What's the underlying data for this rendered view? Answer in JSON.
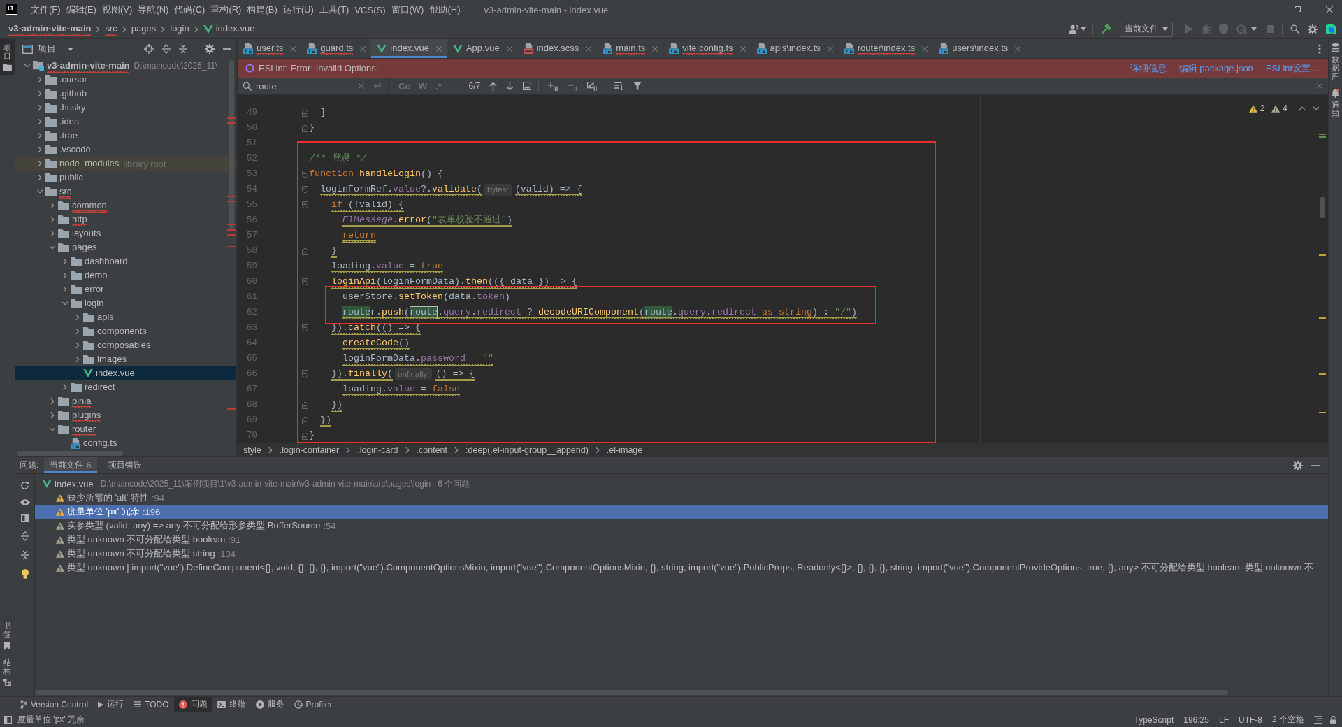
{
  "window": {
    "logo": "IJ",
    "menu": [
      "文件(F)",
      "编辑(E)",
      "视图(V)",
      "导航(N)",
      "代码(C)",
      "重构(R)",
      "构建(B)",
      "运行(U)",
      "工具(T)",
      "VCS(S)",
      "窗口(W)",
      "帮助(H)"
    ],
    "title": "v3-admin-vite-main - index.vue"
  },
  "navigation_bar": {
    "breadcrumbs": [
      {
        "label": "v3-admin-vite-main",
        "kind": "project",
        "has_errors": true
      },
      {
        "label": "src",
        "kind": "folder",
        "has_errors": true
      },
      {
        "label": "pages",
        "kind": "folder",
        "has_errors": false
      },
      {
        "label": "login",
        "kind": "folder",
        "has_errors": false
      },
      {
        "label": "index.vue",
        "kind": "vue",
        "has_errors": false
      }
    ],
    "run_configuration": "当前文件"
  },
  "left_strip": {
    "top": [
      {
        "label": "项目",
        "kind": "project",
        "selected": true
      }
    ],
    "bottom": [
      {
        "label": "书签",
        "kind": "bookmarks",
        "selected": false
      },
      {
        "label": "结构",
        "kind": "structure",
        "selected": false
      }
    ]
  },
  "right_strip": [
    {
      "label": "数据库",
      "kind": "database"
    },
    {
      "label": "通知",
      "kind": "notifications"
    }
  ],
  "project_panel": {
    "title": "项目",
    "tree": [
      {
        "label": "v3-admin-vite-main",
        "kind": "module",
        "path": "D:\\maincode\\2025_11\\",
        "expanded": true,
        "selected": false,
        "has_errors": true,
        "children": [
          {
            "label": ".cursor",
            "kind": "folder",
            "expanded": false,
            "selected": false,
            "has_errors": false
          },
          {
            "label": ".github",
            "kind": "folder",
            "expanded": false,
            "selected": false,
            "has_errors": false
          },
          {
            "label": ".husky",
            "kind": "folder",
            "expanded": false,
            "selected": false,
            "has_errors": false
          },
          {
            "label": ".idea",
            "kind": "folder",
            "expanded": false,
            "selected": false,
            "has_errors": false
          },
          {
            "label": ".trae",
            "kind": "folder",
            "expanded": false,
            "selected": false,
            "has_errors": false
          },
          {
            "label": ".vscode",
            "kind": "folder",
            "expanded": false,
            "selected": false,
            "has_errors": false
          },
          {
            "label": "node_modules",
            "kind": "library",
            "note": "library root",
            "expanded": false,
            "selected": false,
            "has_errors": false
          },
          {
            "label": "public",
            "kind": "folder",
            "expanded": false,
            "selected": false,
            "has_errors": false
          },
          {
            "label": "src",
            "kind": "folder",
            "expanded": true,
            "selected": false,
            "has_errors": true,
            "children": [
              {
                "label": "common",
                "kind": "folder",
                "expanded": false,
                "selected": false,
                "has_errors": true
              },
              {
                "label": "http",
                "kind": "folder",
                "expanded": false,
                "selected": false,
                "has_errors": true
              },
              {
                "label": "layouts",
                "kind": "folder",
                "expanded": false,
                "selected": false,
                "has_errors": false
              },
              {
                "label": "pages",
                "kind": "folder",
                "expanded": true,
                "selected": false,
                "has_errors": false,
                "children": [
                  {
                    "label": "dashboard",
                    "kind": "folder",
                    "expanded": false,
                    "selected": false,
                    "has_errors": false
                  },
                  {
                    "label": "demo",
                    "kind": "folder",
                    "expanded": false,
                    "selected": false,
                    "has_errors": false
                  },
                  {
                    "label": "error",
                    "kind": "folder",
                    "expanded": false,
                    "selected": false,
                    "has_errors": false
                  },
                  {
                    "label": "login",
                    "kind": "folder",
                    "expanded": true,
                    "selected": false,
                    "has_errors": false,
                    "children": [
                      {
                        "label": "apis",
                        "kind": "folder",
                        "expanded": false,
                        "selected": false,
                        "has_errors": false
                      },
                      {
                        "label": "components",
                        "kind": "folder",
                        "expanded": false,
                        "selected": false,
                        "has_errors": false
                      },
                      {
                        "label": "composables",
                        "kind": "folder",
                        "expanded": false,
                        "selected": false,
                        "has_errors": false
                      },
                      {
                        "label": "images",
                        "kind": "folder",
                        "expanded": false,
                        "selected": false,
                        "has_errors": false
                      },
                      {
                        "label": "index.vue",
                        "kind": "vue",
                        "selected": true,
                        "has_errors": false
                      }
                    ]
                  },
                  {
                    "label": "redirect",
                    "kind": "folder",
                    "expanded": false,
                    "selected": false,
                    "has_errors": false
                  }
                ]
              },
              {
                "label": "pinia",
                "kind": "folder",
                "expanded": false,
                "selected": false,
                "has_errors": true
              },
              {
                "label": "plugins",
                "kind": "folder",
                "expanded": false,
                "selected": false,
                "has_errors": true
              },
              {
                "label": "router",
                "kind": "folder",
                "expanded": true,
                "selected": false,
                "has_errors": true,
                "children": [
                  {
                    "label": "config.ts",
                    "kind": "ts",
                    "selected": false,
                    "has_errors": false
                  }
                ]
              }
            ]
          }
        ]
      }
    ]
  },
  "editor": {
    "tabs": [
      {
        "label": "user.ts",
        "kind": "ts",
        "selected": false,
        "has_errors": true
      },
      {
        "label": "guard.ts",
        "kind": "ts",
        "selected": false,
        "has_errors": true
      },
      {
        "label": "index.vue",
        "kind": "vue",
        "selected": true,
        "has_errors": false
      },
      {
        "label": "App.vue",
        "kind": "vue",
        "selected": false,
        "has_errors": false
      },
      {
        "label": "index.scss",
        "kind": "scss",
        "selected": false,
        "has_errors": false
      },
      {
        "label": "main.ts",
        "kind": "ts",
        "selected": false,
        "has_errors": true
      },
      {
        "label": "vite.config.ts",
        "kind": "ts",
        "selected": false,
        "has_errors": true
      },
      {
        "label": "apis\\index.ts",
        "kind": "ts",
        "selected": false,
        "has_errors": false
      },
      {
        "label": "router\\index.ts",
        "kind": "ts",
        "selected": false,
        "has_errors": true
      },
      {
        "label": "users\\index.ts",
        "kind": "ts",
        "selected": false,
        "has_errors": false
      }
    ],
    "notification": {
      "message": "ESLint: Error: Invalid Options:",
      "links": [
        "详细信息",
        "编辑 package.json",
        "ESLint设置..."
      ]
    },
    "find": {
      "query": "route",
      "toggles": [
        {
          "label": "Cc",
          "selected": false
        },
        {
          "label": "W",
          "selected": false
        },
        {
          "label": ".*",
          "selected": false
        }
      ],
      "count": "6/7"
    },
    "inspections": {
      "warnings": "2",
      "weak_warnings": "4"
    },
    "lines": [
      {
        "number": "49",
        "kind": "closing",
        "warning": false,
        "tokens": [
          {
            "text": "  ]",
            "kind": "plain"
          }
        ]
      },
      {
        "number": "50",
        "kind": "closing",
        "warning": false,
        "tokens": [
          {
            "text": "}",
            "kind": "plain"
          }
        ]
      },
      {
        "kind": "annotation",
        "lines": [
          {
            "number": "51",
            "kind": "body"
          },
          {
            "number": "52",
            "kind": "body",
            "warning": false,
            "tokens": [
              {
                "text": "/** 登录 */",
                "kind": "doc"
              }
            ]
          },
          {
            "number": "53",
            "kind": "opening",
            "warning": false,
            "tokens": [
              {
                "text": "function",
                "kind": "keyword"
              },
              {
                "text": " handleLogin",
                "kind": "func"
              },
              {
                "text": "() {",
                "kind": "plain"
              }
            ]
          },
          {
            "number": "54",
            "kind": "opening",
            "warning": true,
            "tokens": [
              {
                "text": "  loginFormRef.",
                "kind": "plain"
              },
              {
                "text": "value",
                "kind": "prop"
              },
              {
                "text": "?.",
                "kind": "plain"
              },
              {
                "text": "validate",
                "kind": "func"
              },
              {
                "text": "(",
                "kind": "plain"
              },
              {
                "text": "bytes:",
                "kind": "hint"
              },
              {
                "text": "(valid) => {",
                "kind": "plain"
              }
            ]
          },
          {
            "number": "55",
            "kind": "opening",
            "warning": true,
            "tokens": [
              {
                "text": "    if",
                "kind": "keyword"
              },
              {
                "text": " (!valid) {",
                "kind": "plain"
              }
            ]
          },
          {
            "number": "56",
            "kind": "body",
            "warning": true,
            "tokens": [
              {
                "text": "      ElMessage",
                "kind": "class"
              },
              {
                "text": ".",
                "kind": "plain"
              },
              {
                "text": "error",
                "kind": "func"
              },
              {
                "text": "(",
                "kind": "plain"
              },
              {
                "text": "\"表单校验不通过\"",
                "kind": "string"
              },
              {
                "text": ")",
                "kind": "plain"
              }
            ]
          },
          {
            "number": "57",
            "kind": "body",
            "warning": true,
            "tokens": [
              {
                "text": "      return",
                "kind": "keyword"
              }
            ]
          },
          {
            "number": "58",
            "kind": "closing",
            "warning": true,
            "tokens": [
              {
                "text": "    }",
                "kind": "plain"
              }
            ]
          },
          {
            "number": "59",
            "kind": "body",
            "warning": true,
            "tokens": [
              {
                "text": "    loading.",
                "kind": "plain"
              },
              {
                "text": "value",
                "kind": "prop"
              },
              {
                "text": " = ",
                "kind": "plain"
              },
              {
                "text": "true",
                "kind": "keyword"
              }
            ]
          },
          {
            "number": "60",
            "kind": "opening",
            "warning": true,
            "tokens": [
              {
                "text": "    loginApi",
                "kind": "func"
              },
              {
                "text": "(loginFormData).",
                "kind": "plain"
              },
              {
                "text": "then",
                "kind": "func"
              },
              {
                "text": "(({ data }) => {",
                "kind": "plain"
              }
            ]
          },
          {
            "kind": "annotation",
            "lines": [
              {
                "number": "61",
                "kind": "body",
                "warning": false,
                "tokens": [
                  {
                    "text": "      userStore.",
                    "kind": "plain"
                  },
                  {
                    "text": "setToken",
                    "kind": "func"
                  },
                  {
                    "text": "(data.",
                    "kind": "plain"
                  },
                  {
                    "text": "token",
                    "kind": "prop"
                  },
                  {
                    "text": ")",
                    "kind": "plain"
                  }
                ]
              },
              {
                "number": "62",
                "kind": "body",
                "warning": true,
                "tokens": [
                  {
                    "text": "      route",
                    "kind": "match"
                  },
                  {
                    "text": "r.",
                    "kind": "plain"
                  },
                  {
                    "text": "push",
                    "kind": "func"
                  },
                  {
                    "text": "(",
                    "kind": "plain"
                  },
                  {
                    "text": "route",
                    "kind": "current"
                  },
                  {
                    "text": ".",
                    "kind": "plain"
                  },
                  {
                    "text": "query",
                    "kind": "prop"
                  },
                  {
                    "text": ".",
                    "kind": "plain"
                  },
                  {
                    "text": "redirect",
                    "kind": "prop"
                  },
                  {
                    "text": " ? ",
                    "kind": "plain"
                  },
                  {
                    "text": "decodeURIComponent",
                    "kind": "func"
                  },
                  {
                    "text": "(",
                    "kind": "plain"
                  },
                  {
                    "text": "route",
                    "kind": "match"
                  },
                  {
                    "text": ".",
                    "kind": "plain"
                  },
                  {
                    "text": "query",
                    "kind": "prop"
                  },
                  {
                    "text": ".",
                    "kind": "plain"
                  },
                  {
                    "text": "redirect",
                    "kind": "prop"
                  },
                  {
                    "text": " as string",
                    "kind": "keyword"
                  },
                  {
                    "text": ") : ",
                    "kind": "plain"
                  },
                  {
                    "text": "\"/\"",
                    "kind": "string"
                  },
                  {
                    "text": ")",
                    "kind": "plain"
                  }
                ]
              }
            ]
          },
          {
            "number": "63",
            "kind": "opening",
            "warning": true,
            "tokens": [
              {
                "text": "    }).",
                "kind": "plain"
              },
              {
                "text": "catch",
                "kind": "func"
              },
              {
                "text": "(() => {",
                "kind": "plain"
              }
            ]
          },
          {
            "number": "64",
            "kind": "body",
            "warning": true,
            "tokens": [
              {
                "text": "      createCode",
                "kind": "func"
              },
              {
                "text": "()",
                "kind": "plain"
              }
            ]
          },
          {
            "number": "65",
            "kind": "body",
            "warning": true,
            "tokens": [
              {
                "text": "      loginFormData.",
                "kind": "plain"
              },
              {
                "text": "password",
                "kind": "prop"
              },
              {
                "text": " = ",
                "kind": "plain"
              },
              {
                "text": "\"\"",
                "kind": "string"
              }
            ]
          },
          {
            "number": "66",
            "kind": "opening",
            "warning": true,
            "tokens": [
              {
                "text": "    }).",
                "kind": "plain"
              },
              {
                "text": "finally",
                "kind": "func"
              },
              {
                "text": "(",
                "kind": "plain"
              },
              {
                "text": "onfinally:",
                "kind": "hint"
              },
              {
                "text": "() => {",
                "kind": "plain"
              }
            ]
          },
          {
            "number": "67",
            "kind": "body",
            "warning": true,
            "tokens": [
              {
                "text": "      loading.",
                "kind": "plain"
              },
              {
                "text": "value",
                "kind": "prop"
              },
              {
                "text": " = ",
                "kind": "plain"
              },
              {
                "text": "false",
                "kind": "keyword"
              }
            ]
          },
          {
            "number": "68",
            "kind": "closing",
            "warning": true,
            "tokens": [
              {
                "text": "    })",
                "kind": "plain"
              }
            ]
          },
          {
            "number": "69",
            "kind": "closing",
            "warning": true,
            "tokens": [
              {
                "text": "  })",
                "kind": "plain"
              }
            ]
          },
          {
            "number": "70",
            "kind": "closing",
            "warning": false,
            "tokens": [
              {
                "text": "}",
                "kind": "plain"
              }
            ]
          }
        ]
      }
    ],
    "breadcrumbs": [
      "style",
      ".login-container",
      ".login-card",
      ".content",
      ":deep(.el-input-group__append)",
      ".el-image"
    ]
  },
  "problems": {
    "title": "问题:",
    "tabs": [
      {
        "label": "当前文件",
        "count": "6",
        "selected": true
      },
      {
        "label": "项目错误",
        "selected": false
      }
    ],
    "file": {
      "name": "index.vue",
      "path": "D:\\maincode\\2025_11\\案例项目\\1\\v3-admin-vite-main\\v3-admin-vite-main\\src\\pages\\login",
      "summary": "6 个问题"
    },
    "items": [
      {
        "message": "缺少所需的 'alt' 特性",
        "line": ":94",
        "kind": "warning",
        "selected": false
      },
      {
        "message": "度量单位 'px' 冗余",
        "line": ":196",
        "kind": "warning",
        "selected": true
      },
      {
        "message": "实参类型 (valid: any) => any 不可分配给形参类型 BufferSource",
        "line": ":54",
        "kind": "weak",
        "selected": false
      },
      {
        "message": "类型 unknown 不可分配给类型 boolean",
        "line": ":91",
        "kind": "weak",
        "selected": false
      },
      {
        "message": "类型 unknown 不可分配给类型 string",
        "line": ":134",
        "kind": "weak",
        "selected": false
      },
      {
        "message": "类型 unknown | import(\"vue\").DefineComponent<{}, void, {}, {}, {}, import(\"vue\").ComponentOptionsMixin, import(\"vue\").ComponentOptionsMixin, {}, string, import(\"vue\").PublicProps, Readonly<{}>, {}, {}, {}, string, import(\"vue\").ComponentProvideOptions, true, {}, any> 不可分配给类型 boolean  类型 unknown 不",
        "kind": "weak",
        "selected": false
      }
    ]
  },
  "bottom_bar": {
    "tools": [
      {
        "label": "Version Control",
        "kind": "vcs",
        "selected": false
      },
      {
        "label": "运行",
        "kind": "run",
        "selected": false
      },
      {
        "label": "TODO",
        "kind": "todo",
        "selected": false
      },
      {
        "label": "问题",
        "kind": "problems",
        "selected": true
      },
      {
        "label": "终端",
        "kind": "terminal",
        "selected": false
      },
      {
        "label": "服务",
        "kind": "services",
        "selected": false
      },
      {
        "label": "Profiler",
        "kind": "profiler",
        "selected": false
      }
    ]
  },
  "status_bar": {
    "message": "度量单位 'px' 冗余",
    "items": [
      "TypeScript",
      "196:25",
      "LF",
      "UTF-8",
      "2 个空格"
    ]
  }
}
